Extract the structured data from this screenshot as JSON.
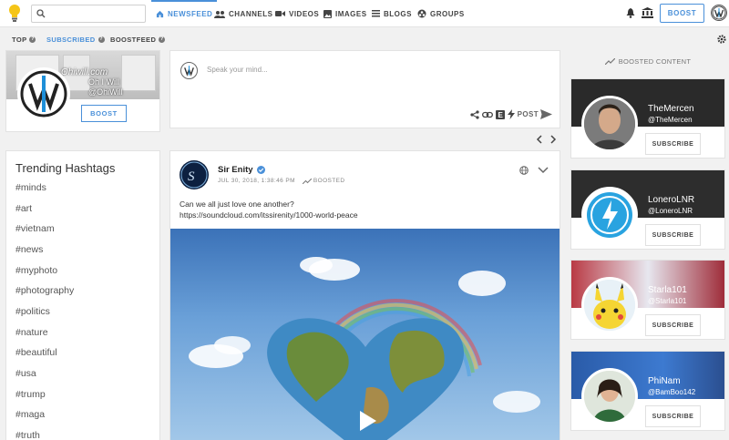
{
  "search": {
    "placeholder": ""
  },
  "nav": {
    "newsfeed": "NEWSFEED",
    "channels": "CHANNELS",
    "videos": "VIDEOS",
    "images": "IMAGES",
    "blogs": "BLOGS",
    "groups": "GROUPS",
    "boost": "BOOST"
  },
  "filters": {
    "top": "TOP",
    "subscribed": "SUBSCRIBED",
    "boostfeed": "BOOSTFEED"
  },
  "profile": {
    "banner_site": "Ohiwill.com",
    "banner_line1": "Oh I Will",
    "banner_line2": "@OhiWill",
    "boost": "BOOST"
  },
  "composer": {
    "placeholder": "Speak your mind...",
    "post": "POST"
  },
  "trending": {
    "title": "Trending Hashtags",
    "tags": [
      "#minds",
      "#art",
      "#vietnam",
      "#news",
      "#myphoto",
      "#photography",
      "#politics",
      "#nature",
      "#beautiful",
      "#usa",
      "#trump",
      "#maga",
      "#truth"
    ]
  },
  "post": {
    "author": "Sir Enity",
    "date": "JUL 30, 2018, 1:38:46 PM",
    "boosted": "BOOSTED",
    "text": "Can we all just love one another?",
    "link": "https://soundcloud.com/itssirenity/1000-world-peace"
  },
  "boosted": {
    "header": "BOOSTED CONTENT",
    "channels": [
      {
        "name": "TheMercen",
        "handle": "@TheMercen",
        "subscribe": "SUBSCRIBE"
      },
      {
        "name": "LoneroLNR",
        "handle": "@LoneroLNR",
        "subscribe": "SUBSCRIBE"
      },
      {
        "name": "Starla101",
        "handle": "@Starla101",
        "subscribe": "SUBSCRIBE"
      },
      {
        "name": "PhiNam",
        "handle": "@BamBoo142",
        "subscribe": "SUBSCRIBE"
      }
    ]
  },
  "colors": {
    "accent": "#4a90d9",
    "background": "#f1f1f1"
  }
}
